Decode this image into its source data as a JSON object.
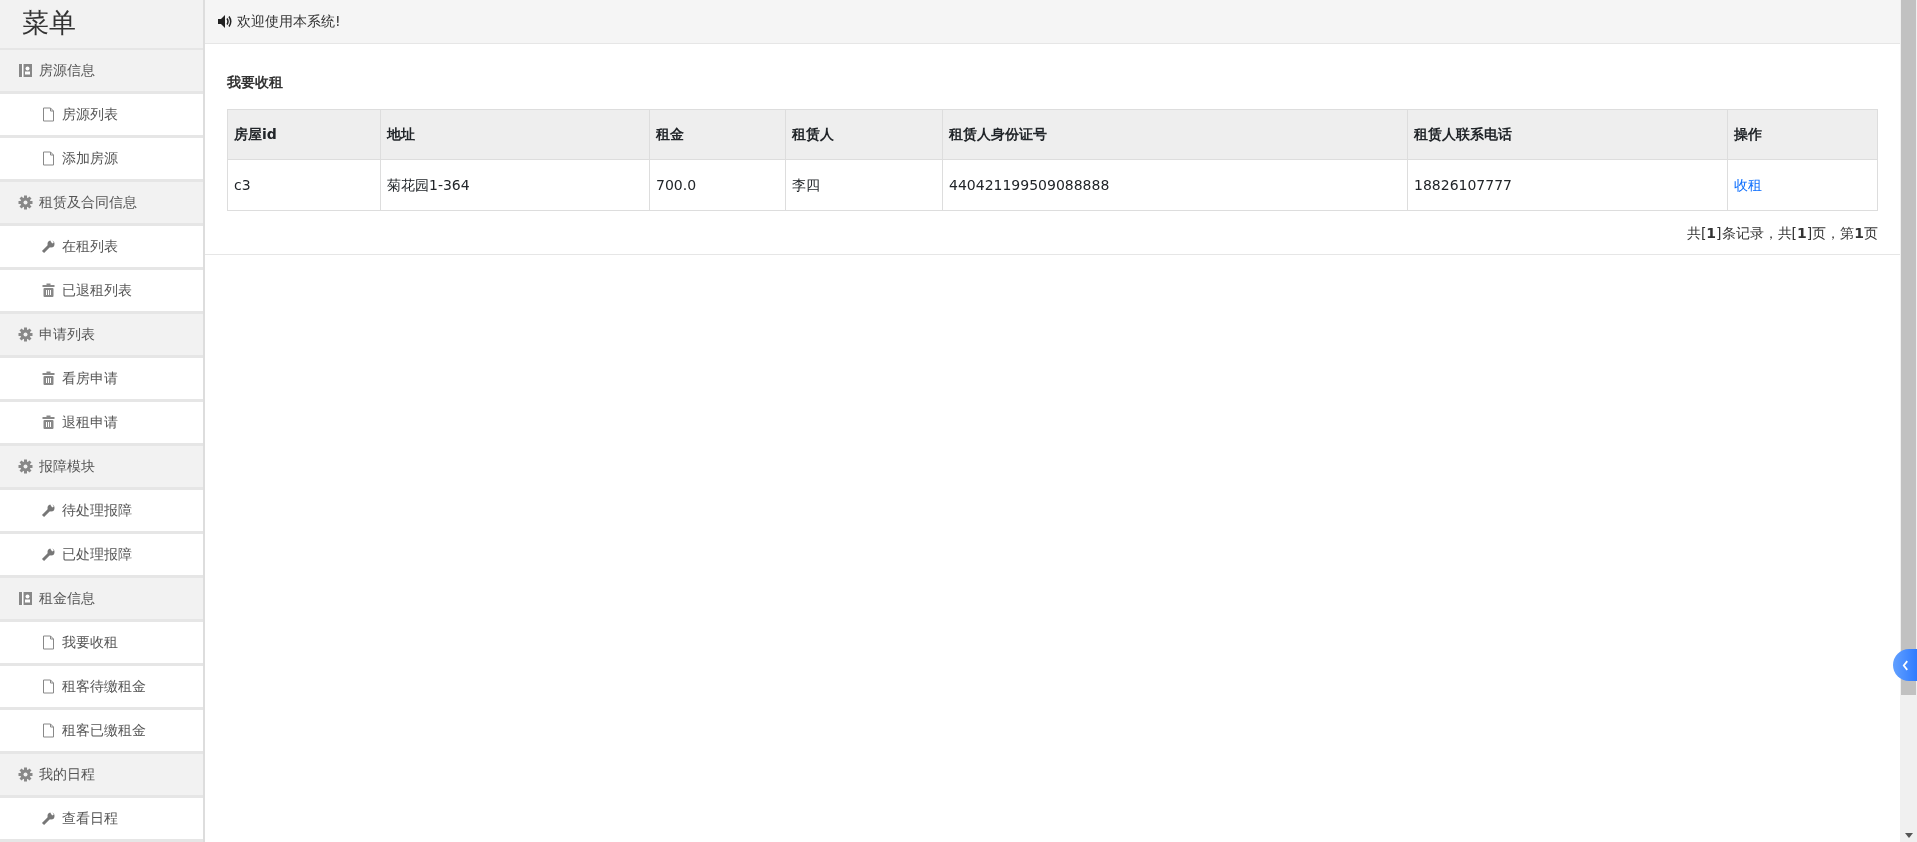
{
  "sidebar": {
    "title": "菜单",
    "groups": [
      {
        "label": "房源信息",
        "kind": "contact",
        "items": [
          {
            "label": "房源列表",
            "kind": "file"
          },
          {
            "label": "添加房源",
            "kind": "file"
          }
        ]
      },
      {
        "label": "租赁及合同信息",
        "kind": "gear",
        "items": [
          {
            "label": "在租列表",
            "kind": "wrench"
          },
          {
            "label": "已退租列表",
            "kind": "trash"
          }
        ]
      },
      {
        "label": "申请列表",
        "kind": "gear",
        "items": [
          {
            "label": "看房申请",
            "kind": "trash"
          },
          {
            "label": "退租申请",
            "kind": "trash"
          }
        ]
      },
      {
        "label": "报障模块",
        "kind": "gear",
        "items": [
          {
            "label": "待处理报障",
            "kind": "wrench"
          },
          {
            "label": "已处理报障",
            "kind": "wrench"
          }
        ]
      },
      {
        "label": "租金信息",
        "kind": "contact",
        "items": [
          {
            "label": "我要收租",
            "kind": "file"
          },
          {
            "label": "租客待缴租金",
            "kind": "file"
          },
          {
            "label": "租客已缴租金",
            "kind": "file"
          }
        ]
      },
      {
        "label": "我的日程",
        "kind": "gear",
        "items": [
          {
            "label": "查看日程",
            "kind": "wrench"
          }
        ]
      }
    ]
  },
  "header": {
    "welcome": "欢迎使用本系统!"
  },
  "content": {
    "title": "我要收租",
    "table": {
      "columns": [
        "房屋id",
        "地址",
        "租金",
        "租赁人",
        "租赁人身份证号",
        "租赁人联系电话",
        "操作"
      ],
      "rows": [
        {
          "cells": [
            "c3",
            "菊花园1-364",
            "700.0",
            "李四",
            "440421199509088888",
            "18826107777"
          ],
          "action": "收租"
        }
      ]
    },
    "pagination": "共[**1**]条记录，共[**1**]页，第**1**页"
  }
}
